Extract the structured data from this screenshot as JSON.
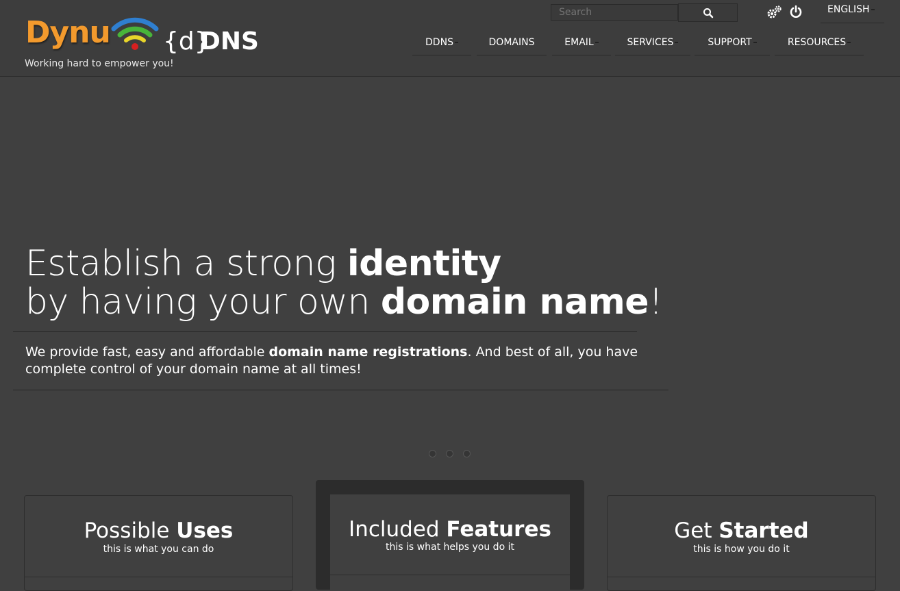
{
  "brand": {
    "logo_word": "Dynu",
    "ddns_brace": "{d}",
    "ddns_bold": "DNS",
    "tagline": "Working hard to empower you!"
  },
  "topbar": {
    "search_placeholder": "Search",
    "language": "ENGLISH"
  },
  "nav": {
    "items": [
      {
        "label": "DDNS"
      },
      {
        "label": "DOMAINS"
      },
      {
        "label": "EMAIL"
      },
      {
        "label": "SERVICES"
      },
      {
        "label": "SUPPORT"
      },
      {
        "label": "RESOURCES"
      }
    ]
  },
  "hero": {
    "line1_light": "Establish a strong ",
    "line1_bold": "identity",
    "line2_light": "by having your own ",
    "line2_bold": "domain name",
    "line2_end": "!",
    "desc_pre": "We provide fast, easy and affordable ",
    "desc_bold": "domain name registrations",
    "desc_post": ". And best of all, you have complete control of your domain name at all times!"
  },
  "slider": {
    "dot_count": 3
  },
  "cards": [
    {
      "title_light": "Possible ",
      "title_bold": "Uses",
      "subtitle": "this is what you can do"
    },
    {
      "title_light": "Included ",
      "title_bold": "Features",
      "subtitle": "this is what helps you do it"
    },
    {
      "title_light": "Get ",
      "title_bold": "Started",
      "subtitle": "this is how you do it"
    }
  ],
  "colors": {
    "background": "#404040",
    "header": "#3d3d3d",
    "brand_orange": "#f39a2d",
    "text": "#ffffff"
  }
}
